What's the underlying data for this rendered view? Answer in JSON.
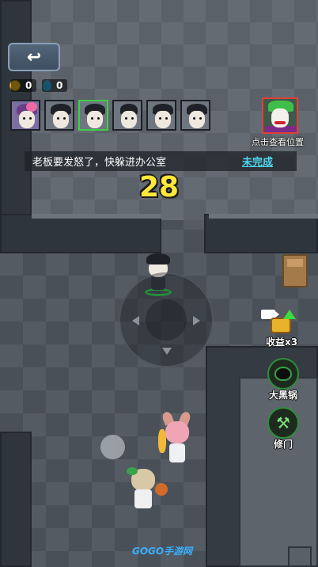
{
  "hud": {
    "back_icon": "↩",
    "coins": "0",
    "water": "0"
  },
  "team": [
    {
      "name": "girl",
      "selected": false
    },
    {
      "name": "student-1",
      "selected": false
    },
    {
      "name": "student-2",
      "selected": true
    },
    {
      "name": "student-3",
      "selected": false
    },
    {
      "name": "student-4",
      "selected": false
    },
    {
      "name": "student-5",
      "selected": false
    }
  ],
  "boss": {
    "label": "点击查看位置"
  },
  "task": {
    "text": "老板要发怒了，快躲进办公室",
    "status": "未完成",
    "status_color": "#4ed8f2"
  },
  "timer": "28",
  "side_buttons": {
    "income": "收益x3",
    "pot": "大黑锅",
    "repair": "修门"
  },
  "watermark": "GOGO手游网"
}
